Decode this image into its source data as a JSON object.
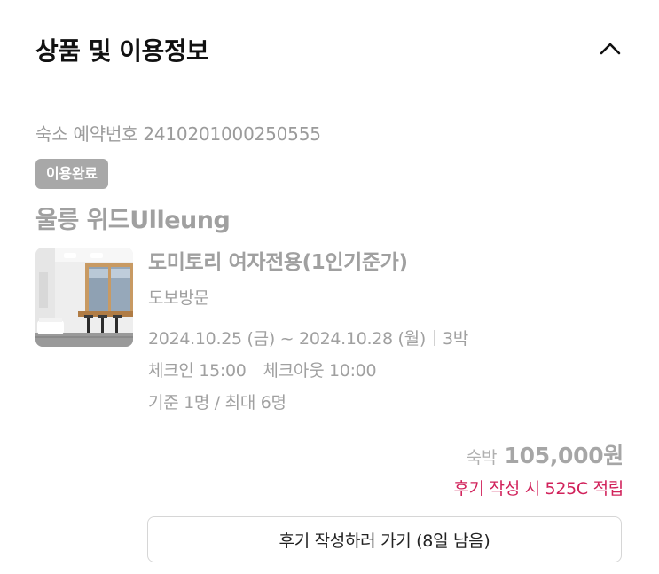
{
  "section": {
    "title": "상품 및 이용정보",
    "toggle_icon": "chevron-up-icon"
  },
  "reservation": {
    "label": "숙소 예약번호",
    "number": "2410201000250555"
  },
  "status_badge": "이용완료",
  "property_name": "울릉 위드Ulleung",
  "room": {
    "name": "도미토리 여자전용(1인기준가)",
    "access": "도보방문",
    "dates": "2024.10.25 (금) ~ 2024.10.28 (월)",
    "nights": "3박",
    "check_in": "체크인 15:00",
    "check_out": "체크아웃 10:00",
    "occupancy": "기준 1명 / 최대 6명"
  },
  "price": {
    "label": "숙박",
    "value": "105,000원"
  },
  "points_text": "후기 작성 시 525C 적립",
  "review_button": "후기 작성하러 가기 (8일 남음)",
  "colors": {
    "accent": "#d1225b",
    "badge_bg": "#a8a8a8",
    "muted_text": "#a0a0a0"
  }
}
